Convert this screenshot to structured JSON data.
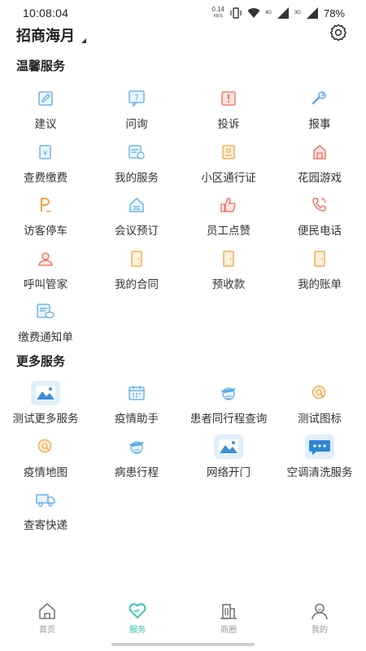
{
  "status_bar": {
    "time": "10:08:04",
    "net_speed": "0.14",
    "net_speed_unit": "KB/S",
    "net_type_1": "4G",
    "net_type_2": "3G",
    "battery": "78%"
  },
  "header": {
    "community_name": "招商海月"
  },
  "sections": [
    {
      "title": "温馨服务",
      "items": [
        {
          "label": "建议",
          "icon": "edit-icon"
        },
        {
          "label": "问询",
          "icon": "question-icon"
        },
        {
          "label": "投诉",
          "icon": "complaint-icon"
        },
        {
          "label": "报事",
          "icon": "wrench-icon"
        },
        {
          "label": "查费缴费",
          "icon": "fee-icon"
        },
        {
          "label": "我的服务",
          "icon": "service-icon"
        },
        {
          "label": "小区通行证",
          "icon": "pass-icon"
        },
        {
          "label": "花园游戏",
          "icon": "garden-icon"
        },
        {
          "label": "访客停车",
          "icon": "parking-icon"
        },
        {
          "label": "会议预订",
          "icon": "meeting-icon"
        },
        {
          "label": "员工点赞",
          "icon": "thumbs-up-icon"
        },
        {
          "label": "便民电话",
          "icon": "phone-icon"
        },
        {
          "label": "呼叫管家",
          "icon": "butler-icon"
        },
        {
          "label": "我的合同",
          "icon": "contract-icon"
        },
        {
          "label": "预收款",
          "icon": "prepay-icon"
        },
        {
          "label": "我的账单",
          "icon": "bill-icon"
        },
        {
          "label": "缴费通知单",
          "icon": "notice-icon"
        }
      ]
    },
    {
      "title": "更多服务",
      "items": [
        {
          "label": "测试更多服务",
          "icon": "image-icon"
        },
        {
          "label": "疫情助手",
          "icon": "calendar-icon"
        },
        {
          "label": "患者同行程查询",
          "icon": "plane-globe-icon"
        },
        {
          "label": "测试图标",
          "icon": "search-circle-icon"
        },
        {
          "label": "疫情地图",
          "icon": "search-circle-icon"
        },
        {
          "label": "病患行程",
          "icon": "plane-globe-icon"
        },
        {
          "label": "网络开门",
          "icon": "image-icon"
        },
        {
          "label": "空调清洗服务",
          "icon": "chat-icon"
        },
        {
          "label": "查寄快递",
          "icon": "truck-icon"
        }
      ]
    }
  ],
  "tabbar": {
    "tabs": [
      {
        "label": "首页",
        "icon": "home-icon",
        "active": false
      },
      {
        "label": "服务",
        "icon": "heart-icon",
        "active": true
      },
      {
        "label": "商圈",
        "icon": "building-icon",
        "active": false
      },
      {
        "label": "我的",
        "icon": "user-icon",
        "active": false
      }
    ]
  },
  "colors": {
    "accent": "#2bbfb4",
    "icon_blue": "#5aa9e6",
    "icon_orange": "#f0a33c",
    "icon_red": "#ef6a5a"
  }
}
